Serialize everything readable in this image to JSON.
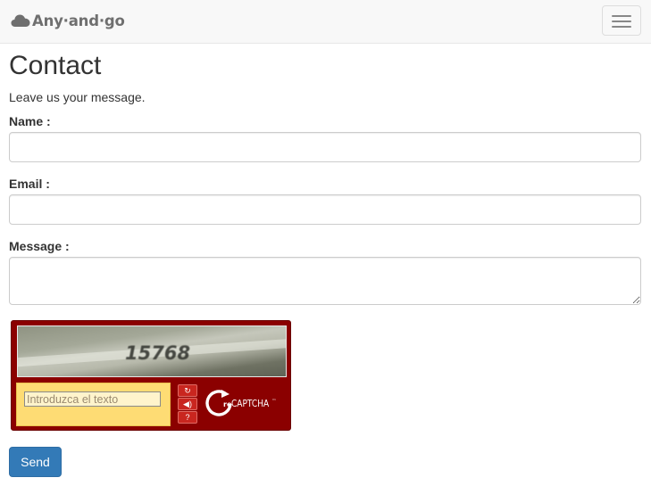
{
  "navbar": {
    "brand": "Any·and·go",
    "brand_icon": "cloud-icon",
    "toggle_icon": "hamburger-menu-icon"
  },
  "page": {
    "title": "Contact",
    "subtitle": "Leave us your message."
  },
  "form": {
    "name_label": "Name :",
    "name_value": "",
    "email_label": "Email :",
    "email_value": "",
    "message_label": "Message :",
    "message_value": "",
    "send_label": "Send"
  },
  "captcha": {
    "challenge_text": "15768",
    "input_placeholder": "Introduzca el texto",
    "logo_re": "re",
    "logo_captcha": "CAPTCHA",
    "logo_tm": "™",
    "reload_icon": "reload-icon",
    "audio_icon": "audio-icon",
    "help_icon": "help-icon",
    "colors": {
      "frame": "#8b0000",
      "input_box": "#fedc74",
      "button": "#c9261f"
    }
  },
  "colors": {
    "primary": "#337ab7",
    "navbar": "#f8f8f8",
    "text": "#333333"
  }
}
